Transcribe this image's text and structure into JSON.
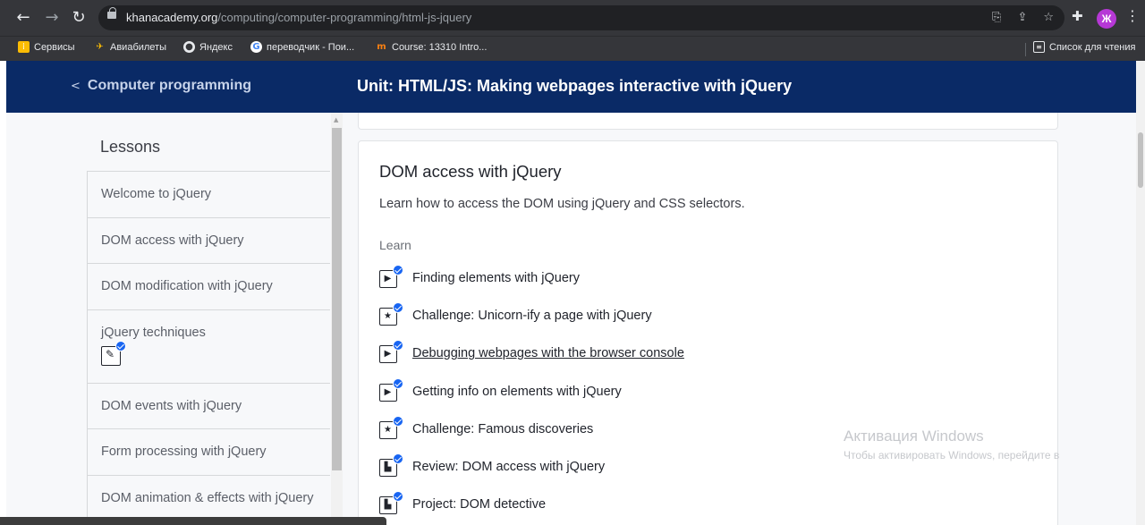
{
  "browser": {
    "url_host": "khanacademy.org",
    "url_path": "/computing/computer-programming/html-js-jquery",
    "profile_initial": "Ж",
    "bookmarks": [
      {
        "label": "Сервисы",
        "icon": "apps-grid-icon",
        "color": "#fbbc04"
      },
      {
        "label": "Авиабилеты",
        "icon": "plane-icon",
        "color": "#fbbc04"
      },
      {
        "label": "Яндекс",
        "icon": "globe-icon",
        "color": "#e8eaed"
      },
      {
        "label": "переводчик - Пои...",
        "icon": "google-icon",
        "color": "#4285f4"
      },
      {
        "label": "Course: 13310 Intro...",
        "icon": "moodle-icon",
        "color": "#f98012"
      },
      {
        "label": "Список для чтения",
        "icon": "reading-list-icon",
        "color": "#e8eaed"
      }
    ]
  },
  "header": {
    "back_label": "Computer programming",
    "unit_title": "Unit: HTML/JS: Making webpages interactive with jQuery"
  },
  "sidebar": {
    "heading": "Lessons",
    "lessons": [
      {
        "label": "Welcome to jQuery"
      },
      {
        "label": "DOM access with jQuery"
      },
      {
        "label": "DOM modification with jQuery"
      },
      {
        "label": "jQuery techniques",
        "badge": "pencil-icon"
      },
      {
        "label": "DOM events with jQuery"
      },
      {
        "label": "Form processing with jQuery"
      },
      {
        "label": "DOM animation & effects with jQuery"
      }
    ]
  },
  "lesson_card": {
    "title": "DOM access with jQuery",
    "description": "Learn how to access the DOM using jQuery and CSS selectors.",
    "section_label": "Learn",
    "items": [
      {
        "label": "Finding elements with jQuery",
        "icon": "video-icon",
        "completed": true
      },
      {
        "label": "Challenge: Unicorn-ify a page with jQuery",
        "icon": "star-icon",
        "completed": true
      },
      {
        "label": "Debugging webpages with the browser console",
        "icon": "video-icon",
        "completed": true,
        "hovered": true
      },
      {
        "label": "Getting info on elements with jQuery",
        "icon": "video-icon",
        "completed": true
      },
      {
        "label": "Challenge: Famous discoveries",
        "icon": "star-icon",
        "completed": true
      },
      {
        "label": "Review: DOM access with jQuery",
        "icon": "document-icon",
        "completed": true
      },
      {
        "label": "Project: DOM detective",
        "icon": "document-icon",
        "completed": true
      }
    ]
  },
  "watermark": {
    "title": "Активация Windows",
    "subtitle": "Чтобы активировать Windows, перейдите в"
  },
  "colors": {
    "header_bg": "#0a2a66",
    "check_blue": "#1865f2",
    "browser_bg": "#35363a"
  }
}
